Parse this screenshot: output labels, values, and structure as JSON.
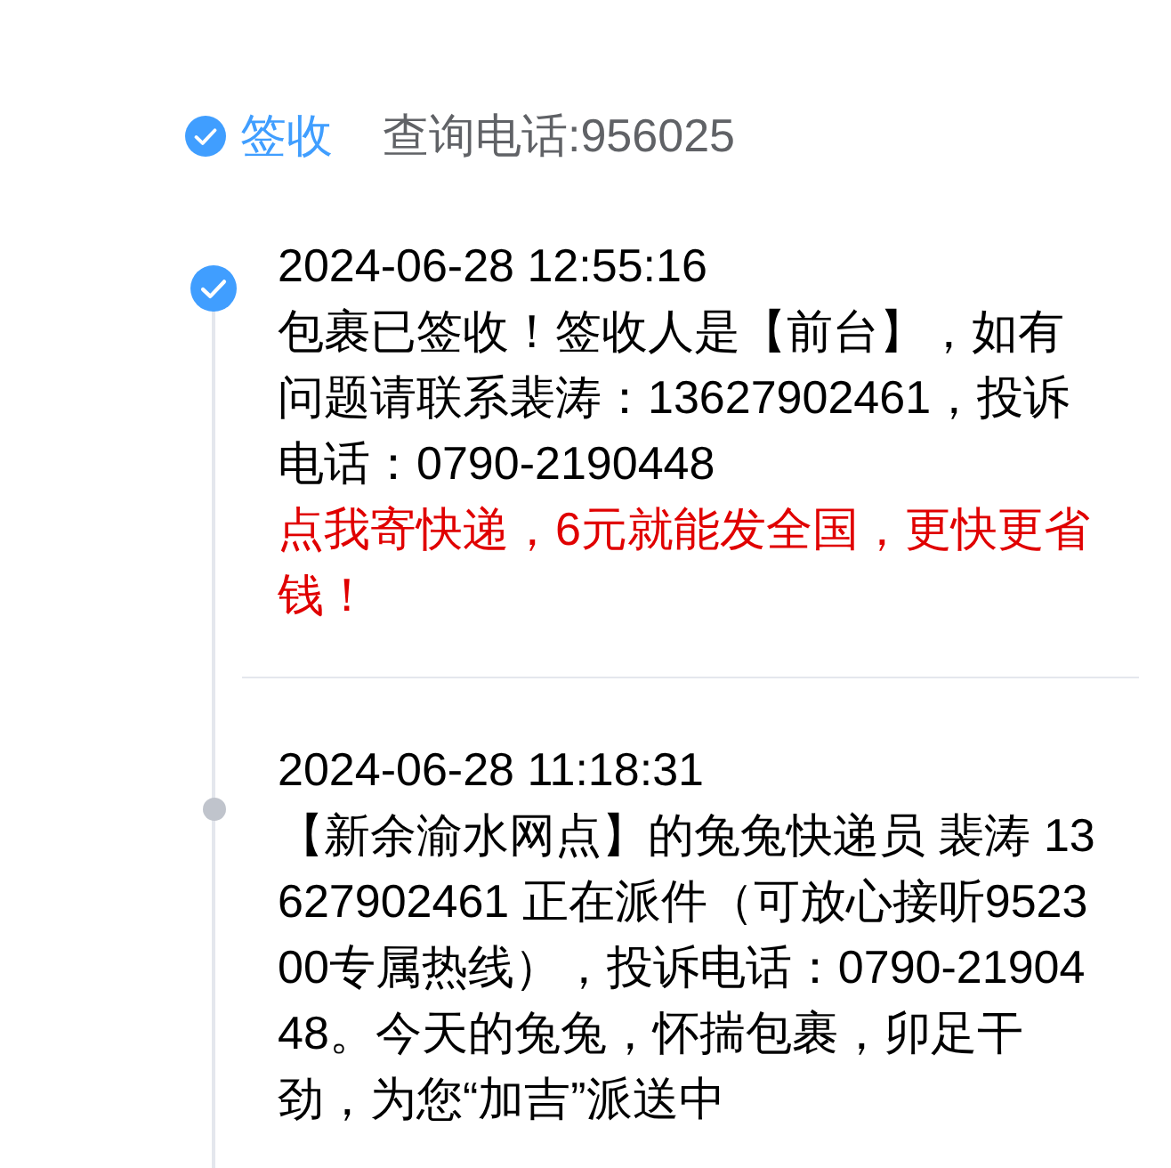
{
  "header": {
    "status": "签收",
    "phone": "查询电话:956025"
  },
  "entries": [
    {
      "active": true,
      "time": "2024-06-28 12:55:16",
      "text": "包裹已签收！签收人是【前台】，如有问题请联系裴涛：13627902461，投诉电话：0790-2190448",
      "promo": "点我寄快递，6元就能发全国，更快更省钱！"
    },
    {
      "active": false,
      "time": "2024-06-28 11:18:31",
      "text": "【新余渝水网点】的兔兔快递员 裴涛 13627902461 正在派件（可放心接听952300专属热线），投诉电话：0790-2190448。今天的兔兔，怀揣包裹，卯足干劲，为您“加吉”派送中"
    }
  ]
}
